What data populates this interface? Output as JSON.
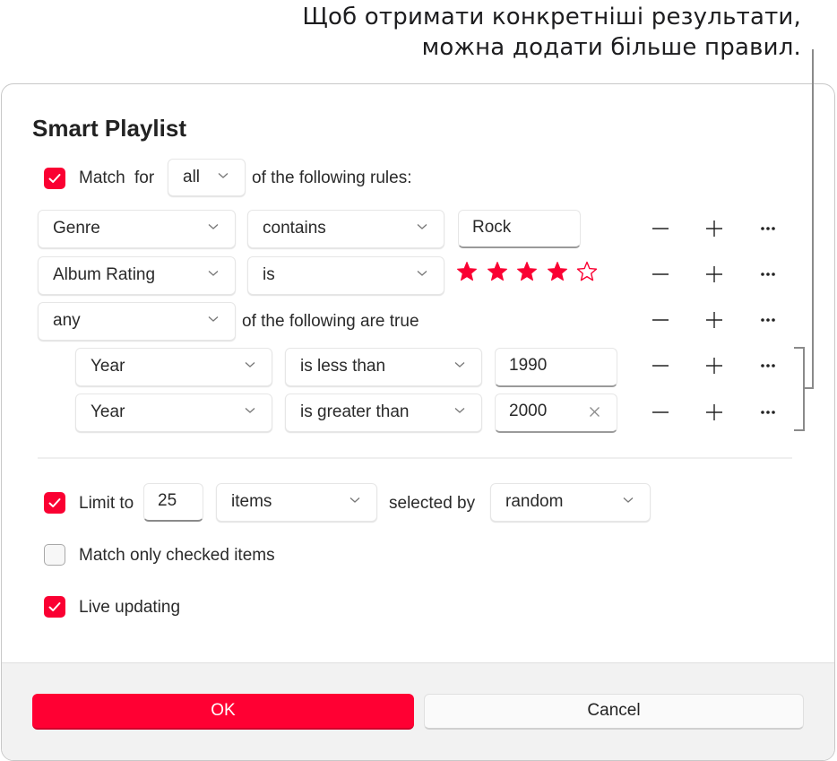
{
  "callout": {
    "lines": [
      "Щоб отримати конкретніші результати,",
      "можна додати більше правил."
    ]
  },
  "dialog": {
    "title": "Smart Playlist",
    "match": {
      "checked": true,
      "label_match": "Match",
      "label_for": "for",
      "quantifier": "all",
      "suffix": "of the following rules:"
    },
    "rules": [
      {
        "field": "Genre",
        "operator": "contains",
        "value": "Rock"
      },
      {
        "field": "Album Rating",
        "operator": "is",
        "rating": 4,
        "rating_max": 5
      }
    ],
    "group": {
      "quantifier": "any",
      "suffix": "of the following are true",
      "rules": [
        {
          "field": "Year",
          "operator": "is less than",
          "value": "1990"
        },
        {
          "field": "Year",
          "operator": "is greater than",
          "value": "2000",
          "clearable": true
        }
      ]
    },
    "limit": {
      "checked": true,
      "label": "Limit to",
      "count": "25",
      "unit": "items",
      "selected_by_label": "selected by",
      "selected_by": "random"
    },
    "match_checked": {
      "checked": false,
      "label": "Match only checked items"
    },
    "live_updating": {
      "checked": true,
      "label": "Live updating"
    },
    "buttons": {
      "ok": "OK",
      "cancel": "Cancel"
    }
  },
  "colors": {
    "accent": "#ff0033",
    "star": "#fa0032",
    "bracket": "#8a8a8a"
  }
}
